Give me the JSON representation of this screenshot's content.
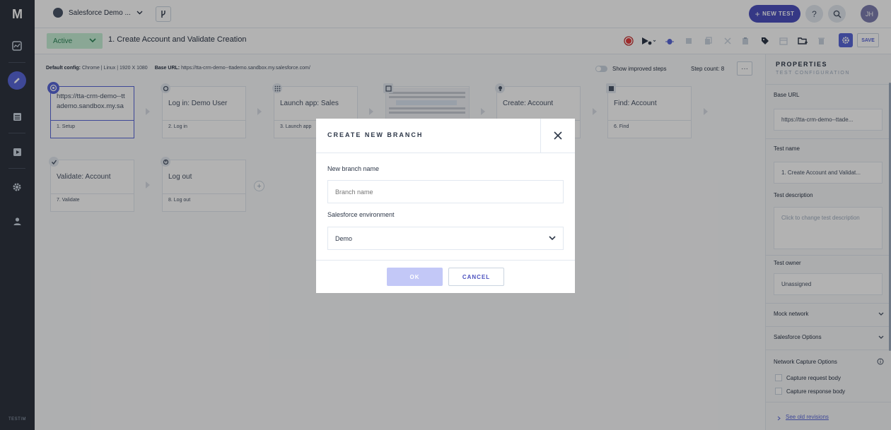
{
  "app": {
    "logo": "M",
    "brand": "TESTIM"
  },
  "topbar": {
    "project_name": "Salesforce Demo ...",
    "new_test_label": "NEW TEST",
    "help_label": "?",
    "avatar_initials": "JH"
  },
  "testbar": {
    "status": "Active",
    "test_title": "1. Create Account and Validate Creation",
    "save_label": "SAVE"
  },
  "config": {
    "default_config_label": "Default config:",
    "default_config_value": "Chrome | Linux | 1920 X 1080",
    "base_url_label": "Base URL:",
    "base_url_value": "https://tta-crm-demo--ttademo.sandbox.my.salesforce.com/",
    "show_improved_label": "Show improved steps",
    "step_count_label": "Step count: 8",
    "more_label": "···"
  },
  "steps": [
    {
      "main": "https://tta-crm-demo--ttademo.sandbox.my.sa",
      "foot": "1. Setup"
    },
    {
      "main": "Log in: Demo User",
      "foot": "2. Log in"
    },
    {
      "main": "Launch app: Sales",
      "foot": "3. Launch app"
    },
    {
      "main": "",
      "foot": ""
    },
    {
      "main": "Create: Account",
      "foot": ""
    },
    {
      "main": "Find: Account",
      "foot": "6. Find"
    },
    {
      "main": "Validate: Account",
      "foot": "7. Validate"
    },
    {
      "main": "Log out",
      "foot": "8. Log out"
    }
  ],
  "properties": {
    "title": "PROPERTIES",
    "subtitle": "TEST CONFIGURATION",
    "base_url_label": "Base URL",
    "base_url_value": "https://tta-crm-demo--ttade...",
    "test_name_label": "Test name",
    "test_name_value": "1. Create Account and Validat...",
    "test_description_label": "Test description",
    "test_description_placeholder": "Click to change test description",
    "test_owner_label": "Test owner",
    "test_owner_value": "Unassigned",
    "mock_network_label": "Mock network",
    "salesforce_options_label": "Salesforce Options",
    "network_capture_label": "Network Capture Options",
    "capture_request_label": "Capture request body",
    "capture_response_label": "Capture response body",
    "old_revisions_label": "See old revisions"
  },
  "modal": {
    "title": "CREATE NEW BRANCH",
    "branch_name_label": "New branch name",
    "branch_name_placeholder": "Branch name",
    "env_label": "Salesforce environment",
    "env_value": "Demo",
    "ok_label": "OK",
    "cancel_label": "CANCEL"
  },
  "colors": {
    "accent": "#5a67d8",
    "nav_bg": "#2e3440",
    "active_status": "#c6f0d6"
  }
}
